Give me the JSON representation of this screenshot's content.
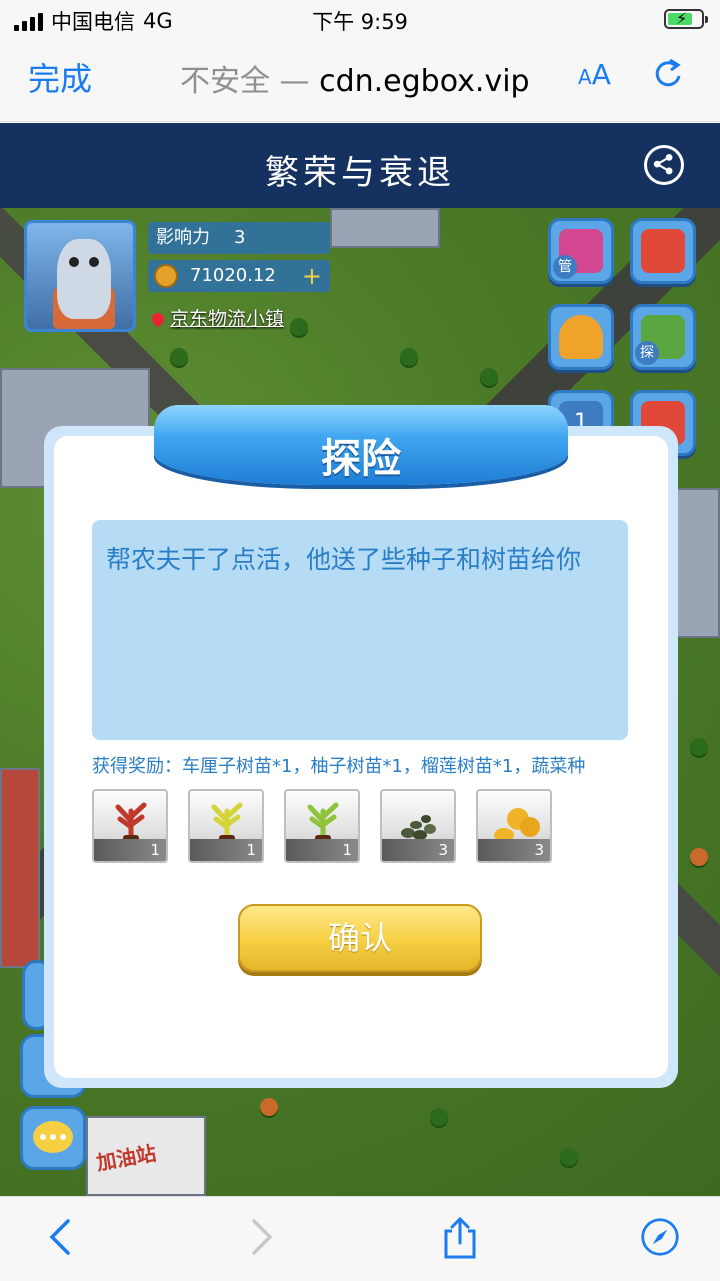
{
  "status_bar": {
    "carrier": "中国电信",
    "network": "4G",
    "time": "下午 9:59"
  },
  "browser": {
    "done_label": "完成",
    "insecure_label": "不安全 —",
    "domain": "cdn.egbox.vip",
    "aa_label_small": "A",
    "aa_label_large": "A"
  },
  "page": {
    "title": "繁荣与衰退"
  },
  "player": {
    "influence_label": "影响力",
    "influence_value": "3",
    "coins": "71020.12",
    "plus": "+",
    "location": "京东物流小镇"
  },
  "side_buttons": [
    {
      "name": "manage",
      "tag": "管"
    },
    {
      "name": "calendar",
      "tag": ""
    },
    {
      "name": "bell",
      "tag": ""
    },
    {
      "name": "explore",
      "tag": "探"
    },
    {
      "name": "rank",
      "tag": "1"
    },
    {
      "name": "gift",
      "tag": ""
    }
  ],
  "map_labels": {
    "gas_station": "加油站"
  },
  "dialog": {
    "title": "探险",
    "message": "帮农夫干了点活，他送了些种子和树苗给你",
    "reward_text": "获得奖励：车厘子树苗*1，柚子树苗*1，榴莲树苗*1，蔬菜种",
    "items": [
      {
        "name": "cherry-sapling",
        "qty": "1",
        "color": "#c0392b"
      },
      {
        "name": "pomelo-sapling",
        "qty": "1",
        "color": "#d4d43a"
      },
      {
        "name": "durian-sapling",
        "qty": "1",
        "color": "#8fc43a"
      },
      {
        "name": "vegetable-seeds",
        "qty": "3",
        "color": "#4a5a3a"
      },
      {
        "name": "golden-seeds",
        "qty": "3",
        "color": "#f0b429"
      }
    ],
    "confirm_label": "确认"
  }
}
